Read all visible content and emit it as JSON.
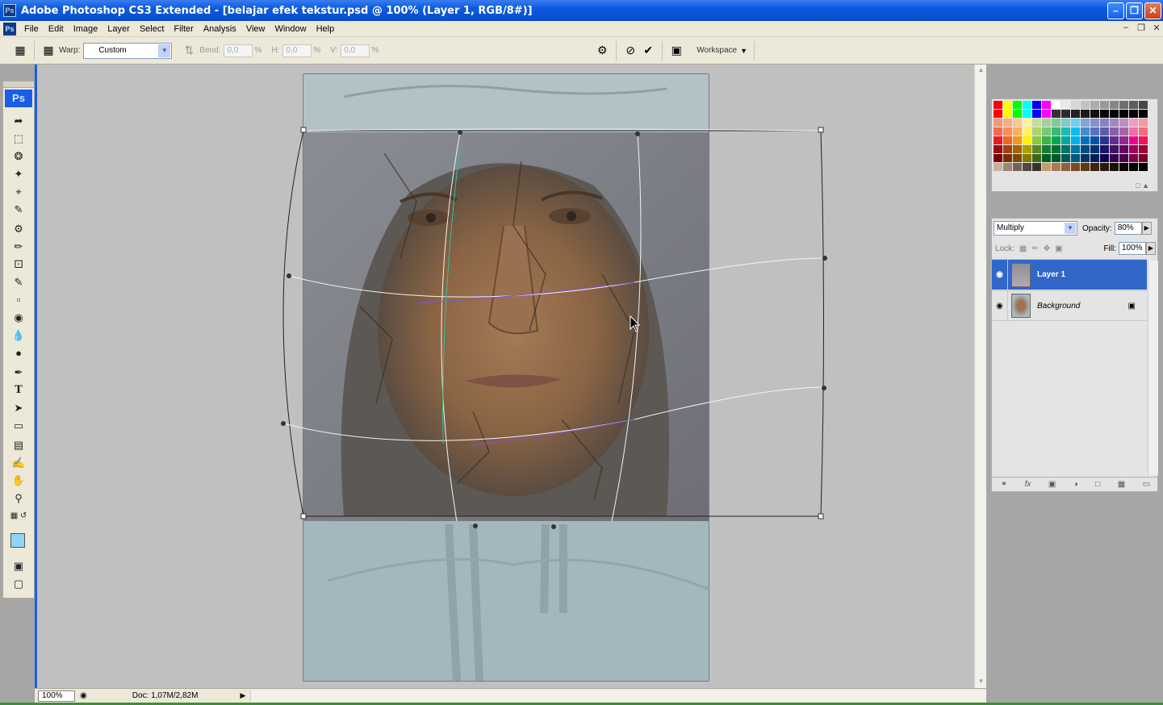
{
  "window": {
    "title": "Adobe Photoshop CS3 Extended - [belajar efek tekstur.psd @ 100% (Layer 1, RGB/8#)]",
    "app_icon": "Ps",
    "controls": [
      "minimize",
      "maximize",
      "close"
    ]
  },
  "menu": {
    "items": [
      "File",
      "Edit",
      "Image",
      "Layer",
      "Select",
      "Filter",
      "Analysis",
      "View",
      "Window",
      "Help"
    ]
  },
  "options": {
    "warp_label": "Warp:",
    "warp_value": "Custom",
    "bend_label": "Bend:",
    "bend_value": "0,0",
    "h_label": "H:",
    "h_value": "0,0",
    "v_label": "V:",
    "v_value": "0,0",
    "percent": "%",
    "workspace_label": "Workspace"
  },
  "toolbox": {
    "logo": "Ps",
    "tools": [
      "move-tool",
      "marquee-tool",
      "lasso-tool",
      "magic-wand-tool",
      "crop-tool",
      "eyedropper-slice-tool",
      "healing-brush-tool",
      "brush-tool",
      "clone-stamp-tool",
      "history-brush-tool",
      "eraser-tool",
      "paint-bucket-tool",
      "blur-tool",
      "dodge-tool",
      "pen-tool",
      "type-tool",
      "path-selection-tool",
      "shape-tool",
      "notes-tool",
      "eyedropper-tool",
      "hand-tool",
      "zoom-tool"
    ],
    "foreground_color": "#8ed4f5",
    "background_color": "#ffffff"
  },
  "status": {
    "zoom": "100%",
    "doc": "Doc: 1,07M/2,82M"
  },
  "layers_panel": {
    "blend_mode": "Multiply",
    "opacity_label": "Opacity:",
    "opacity": "80%",
    "lock_label": "Lock:",
    "fill_label": "Fill:",
    "fill": "100%",
    "layers": [
      {
        "name": "Layer 1",
        "selected": true
      },
      {
        "name": "Background",
        "selected": false,
        "locked": true
      }
    ]
  },
  "colors": {
    "accent": "#1a5ee8",
    "selected_layer": "#3067c9"
  }
}
